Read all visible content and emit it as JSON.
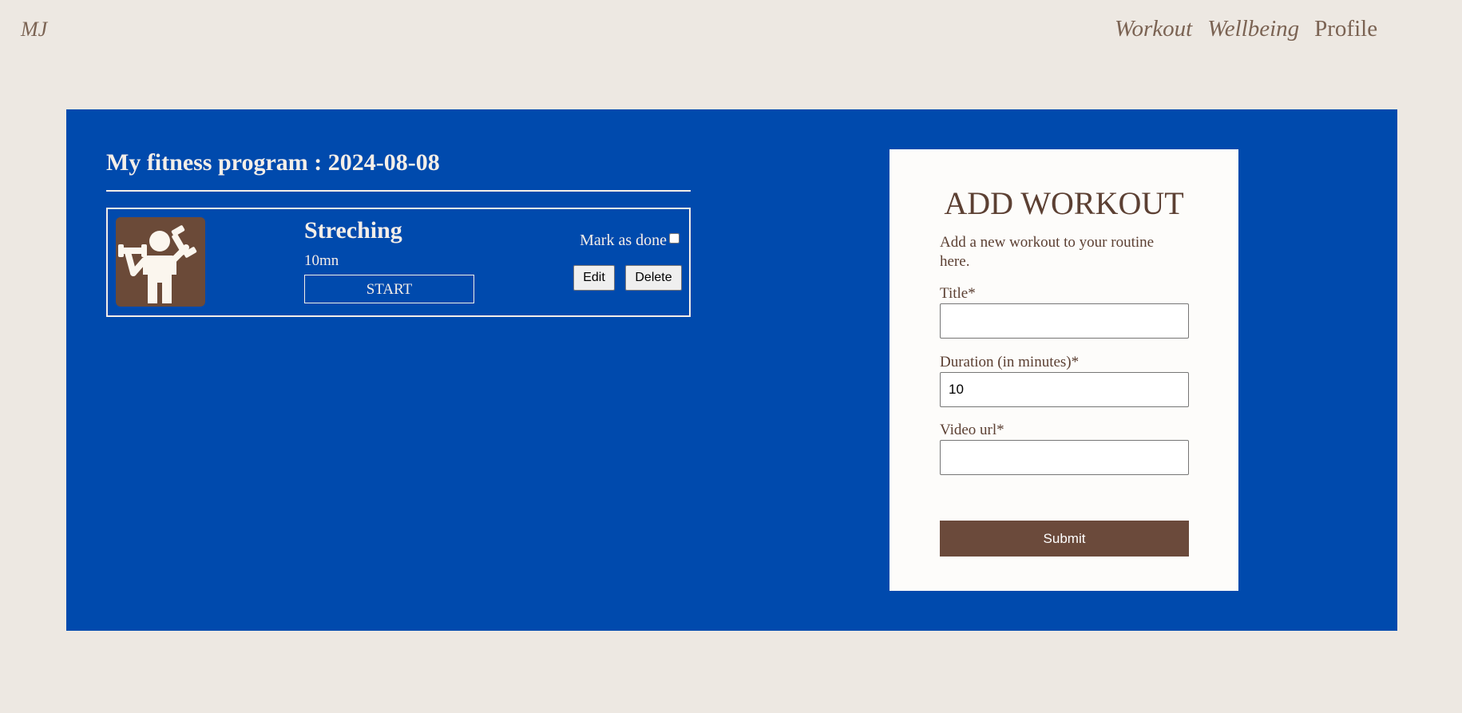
{
  "brand": "MJ",
  "nav": {
    "workout": "Workout",
    "wellbeing": "Wellbeing",
    "profile": "Profile"
  },
  "program": {
    "title": "My fitness program : 2024-08-08",
    "workouts": [
      {
        "name": "Streching",
        "duration": "10mn",
        "start_label": "START",
        "mark_done_label": "Mark as done",
        "done": false,
        "edit_label": "Edit",
        "delete_label": "Delete",
        "icon": "weightlifting-person-icon"
      }
    ]
  },
  "form": {
    "title": "ADD WORKOUT",
    "description": "Add a new workout to your routine here.",
    "title_label": "Title*",
    "title_value": "",
    "duration_label": "Duration (in minutes)*",
    "duration_value": "10",
    "video_label": "Video url*",
    "video_value": "",
    "submit_label": "Submit"
  },
  "colors": {
    "background": "#ede8e2",
    "panel": "#004aad",
    "accent_brown": "#6b4a3b",
    "text_brown": "#5c4033",
    "light_text": "#f4eee8"
  }
}
